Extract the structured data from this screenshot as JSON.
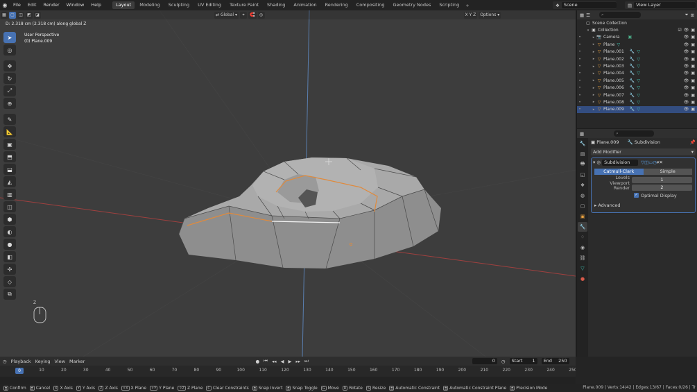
{
  "app": {
    "menus": [
      "File",
      "Edit",
      "Render",
      "Window",
      "Help"
    ],
    "workspaces": [
      "Layout",
      "Modeling",
      "Sculpting",
      "UV Editing",
      "Texture Paint",
      "Shading",
      "Animation",
      "Rendering",
      "Compositing",
      "Geometry Nodes",
      "Scripting"
    ],
    "active_workspace": "Layout",
    "scene": "Scene",
    "view_layer": "View Layer"
  },
  "viewport": {
    "status": "D: 2.318 cm (2.318 cm) along global Z",
    "perspective": "User Perspective",
    "object": "(0) Plane.009",
    "orientation": "Global",
    "options": "Options",
    "axes": "X Y Z",
    "axis_z": "Z",
    "accent": "#e08a3c"
  },
  "outliner": {
    "root": "Scene Collection",
    "collection": "Collection",
    "items": [
      {
        "name": "Camera",
        "kind": "camera"
      },
      {
        "name": "Plane",
        "kind": "mesh"
      },
      {
        "name": "Plane.001",
        "kind": "mesh"
      },
      {
        "name": "Plane.002",
        "kind": "mesh"
      },
      {
        "name": "Plane.003",
        "kind": "mesh"
      },
      {
        "name": "Plane.004",
        "kind": "mesh"
      },
      {
        "name": "Plane.005",
        "kind": "mesh"
      },
      {
        "name": "Plane.006",
        "kind": "mesh"
      },
      {
        "name": "Plane.007",
        "kind": "mesh"
      },
      {
        "name": "Plane.008",
        "kind": "mesh"
      },
      {
        "name": "Plane.009",
        "kind": "mesh",
        "selected": true
      }
    ]
  },
  "properties": {
    "object": "Plane.009",
    "modifier_context": "Subdivision",
    "add_modifier": "Add Modifier",
    "modifier": {
      "name": "Subdivision",
      "mode_left": "Catmull-Clark",
      "mode_right": "Simple",
      "levels_viewport_label": "Levels Viewport",
      "levels_viewport": "1",
      "render_label": "Render",
      "render": "2",
      "optimal_display": "Optimal Display",
      "advanced": "Advanced"
    }
  },
  "timeline": {
    "menus": [
      "Playback",
      "Keying",
      "View",
      "Marker"
    ],
    "current_frame": "0",
    "start_label": "Start",
    "start": "1",
    "end_label": "End",
    "end": "250",
    "ticks": [
      "0",
      "10",
      "20",
      "30",
      "40",
      "50",
      "60",
      "70",
      "80",
      "90",
      "100",
      "110",
      "120",
      "130",
      "140",
      "150",
      "160",
      "170",
      "180",
      "190",
      "200",
      "210",
      "220",
      "230",
      "240",
      "250"
    ]
  },
  "statusbar": {
    "items": [
      {
        "key": "",
        "label": "Confirm"
      },
      {
        "key": "",
        "label": "Cancel"
      },
      {
        "key": "X",
        "label": "X Axis"
      },
      {
        "key": "Y",
        "label": "Y Axis"
      },
      {
        "key": "Z",
        "label": "Z Axis"
      },
      {
        "key": "⇧X",
        "label": "X Plane"
      },
      {
        "key": "⇧Y",
        "label": "Y Plane"
      },
      {
        "key": "⇧Z",
        "label": "Z Plane"
      },
      {
        "key": "C",
        "label": "Clear Constraints"
      },
      {
        "key": "",
        "label": "Snap Invert"
      },
      {
        "key": "",
        "label": "Snap Toggle"
      },
      {
        "key": "G",
        "label": "Move"
      },
      {
        "key": "R",
        "label": "Rotate"
      },
      {
        "key": "S",
        "label": "Resize"
      },
      {
        "key": "",
        "label": "Automatic Constraint"
      },
      {
        "key": "",
        "label": "Automatic Constraint Plane"
      },
      {
        "key": "",
        "label": "Precision Mode"
      }
    ],
    "info": "Plane.009 | Verts:14/42 | Edges:13/67 | Faces:0/26 | Tr"
  }
}
